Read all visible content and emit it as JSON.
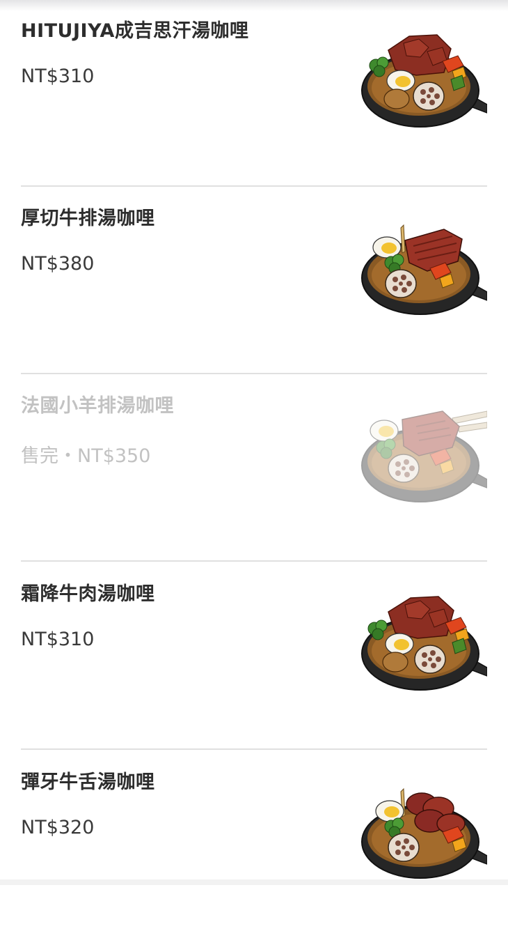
{
  "menu": {
    "items": [
      {
        "name": "HITUJIYA成吉思汗湯咖哩",
        "price": "NT$310",
        "image": "lamb-curry-skillet-icon",
        "sold_out": false
      },
      {
        "name": "厚切牛排湯咖哩",
        "price": "NT$380",
        "image": "steak-curry-skillet-icon",
        "sold_out": false
      },
      {
        "name": "法國小羊排湯咖哩",
        "price": "售完・NT$350",
        "image": "lamb-chop-curry-skillet-icon",
        "sold_out": true
      },
      {
        "name": "霜降牛肉湯咖哩",
        "price": "NT$310",
        "image": "marbled-beef-curry-skillet-icon",
        "sold_out": false
      },
      {
        "name": "彈牙牛舌湯咖哩",
        "price": "NT$320",
        "image": "beef-tongue-curry-skillet-icon",
        "sold_out": false
      }
    ]
  },
  "colors": {
    "text": "#2d2d2d",
    "sold_out_text": "#c2c2c2",
    "divider": "#e0e0e0",
    "background": "#ffffff"
  }
}
